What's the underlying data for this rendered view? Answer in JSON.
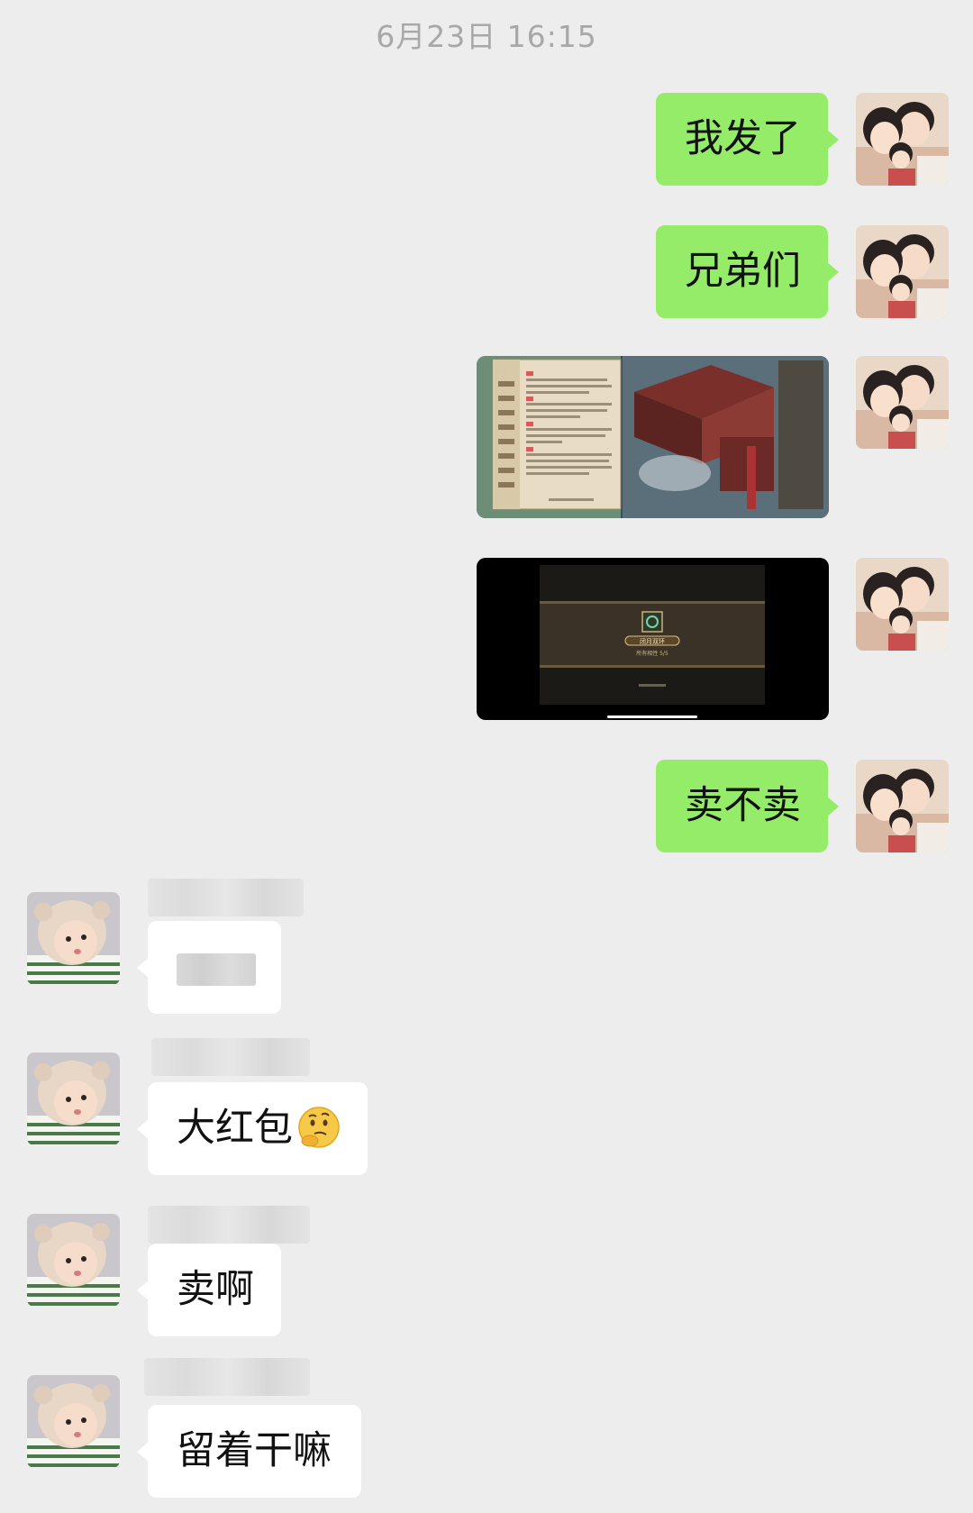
{
  "chat": {
    "timestamp": "6月23日 16:15",
    "messages": [
      {
        "sender": "me",
        "type": "text",
        "text": "我发了"
      },
      {
        "sender": "me",
        "type": "text",
        "text": "兄弟们"
      },
      {
        "sender": "me",
        "type": "image",
        "description": "game-chat-screenshot"
      },
      {
        "sender": "me",
        "type": "image",
        "description": "game-item-screenshot"
      },
      {
        "sender": "me",
        "type": "text",
        "text": "卖不卖"
      },
      {
        "sender": "other",
        "type": "text",
        "text": ""
      },
      {
        "sender": "other",
        "type": "text",
        "text": "大红包",
        "emoji": "thinking-face-icon"
      },
      {
        "sender": "other",
        "type": "text",
        "text": "卖啊"
      },
      {
        "sender": "other",
        "type": "text",
        "text": "留着干嘛"
      }
    ]
  },
  "game_screenshot_2": {
    "item_name": "闭月双环",
    "item_attr": "所有相性 5/5"
  },
  "colors": {
    "background": "#ededed",
    "my_bubble": "#95ec69",
    "their_bubble": "#ffffff",
    "timestamp_text": "#a8a8a8"
  }
}
